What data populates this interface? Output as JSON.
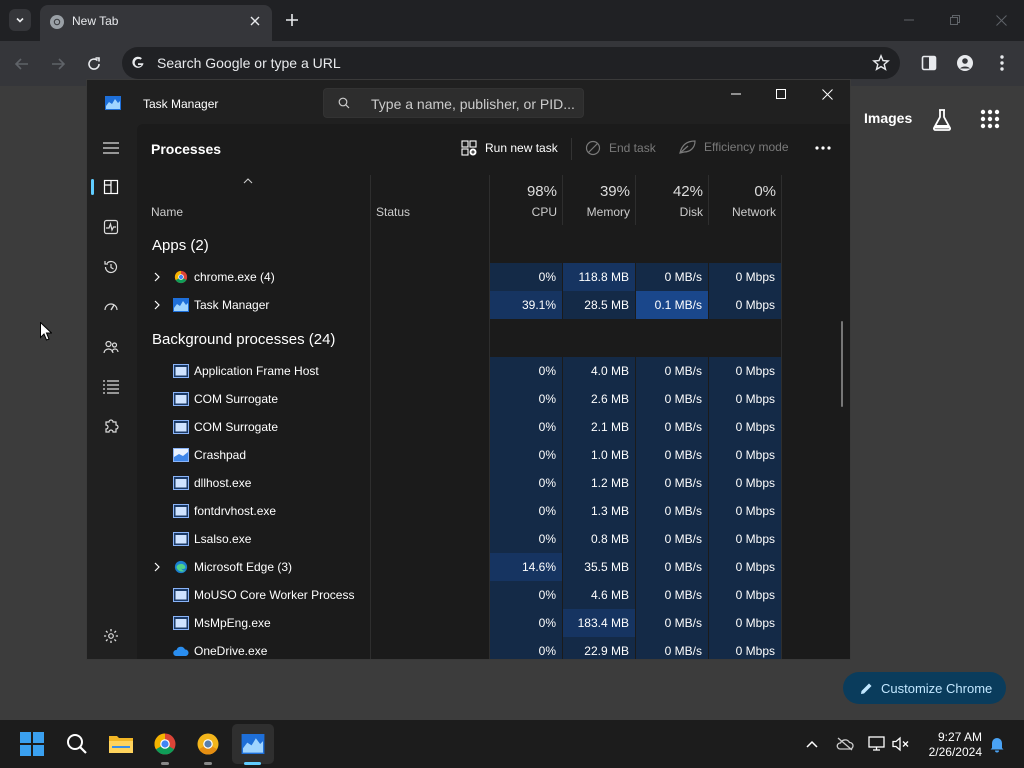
{
  "browser": {
    "tab_title": "New Tab",
    "omnibox_placeholder": "Search Google or type a URL",
    "images_link": "Images",
    "customize_label": "Customize Chrome"
  },
  "task_manager": {
    "title": "Task Manager",
    "search_placeholder": "Type a name, publisher, or PID...",
    "page_title": "Processes",
    "commands": {
      "run_new_task": "Run new task",
      "end_task": "End task",
      "efficiency_mode": "Efficiency mode"
    },
    "columns": {
      "name": "Name",
      "status": "Status",
      "cpu_pct": "98%",
      "cpu": "CPU",
      "memory_pct": "39%",
      "memory": "Memory",
      "disk_pct": "42%",
      "disk": "Disk",
      "network_pct": "0%",
      "network": "Network"
    },
    "apps_group": "Apps (2)",
    "apps": [
      {
        "name": "chrome.exe (4)",
        "cpu": "0%",
        "memory": "118.8 MB",
        "disk": "0 MB/s",
        "network": "0 Mbps"
      },
      {
        "name": "Task Manager",
        "cpu": "39.1%",
        "memory": "28.5 MB",
        "disk": "0.1 MB/s",
        "network": "0 Mbps"
      }
    ],
    "background_group": "Background processes (24)",
    "background": [
      {
        "name": "Application Frame Host",
        "cpu": "0%",
        "memory": "4.0 MB",
        "disk": "0 MB/s",
        "network": "0 Mbps"
      },
      {
        "name": "COM Surrogate",
        "cpu": "0%",
        "memory": "2.6 MB",
        "disk": "0 MB/s",
        "network": "0 Mbps"
      },
      {
        "name": "COM Surrogate",
        "cpu": "0%",
        "memory": "2.1 MB",
        "disk": "0 MB/s",
        "network": "0 Mbps"
      },
      {
        "name": "Crashpad",
        "cpu": "0%",
        "memory": "1.0 MB",
        "disk": "0 MB/s",
        "network": "0 Mbps"
      },
      {
        "name": "dllhost.exe",
        "cpu": "0%",
        "memory": "1.2 MB",
        "disk": "0 MB/s",
        "network": "0 Mbps"
      },
      {
        "name": "fontdrvhost.exe",
        "cpu": "0%",
        "memory": "1.3 MB",
        "disk": "0 MB/s",
        "network": "0 Mbps"
      },
      {
        "name": "Lsalso.exe",
        "cpu": "0%",
        "memory": "0.8 MB",
        "disk": "0 MB/s",
        "network": "0 Mbps"
      },
      {
        "name": "Microsoft Edge (3)",
        "cpu": "14.6%",
        "memory": "35.5 MB",
        "disk": "0 MB/s",
        "network": "0 Mbps"
      },
      {
        "name": "MoUSO Core Worker Process",
        "cpu": "0%",
        "memory": "4.6 MB",
        "disk": "0 MB/s",
        "network": "0 Mbps"
      },
      {
        "name": "MsMpEng.exe",
        "cpu": "0%",
        "memory": "183.4 MB",
        "disk": "0 MB/s",
        "network": "0 Mbps"
      },
      {
        "name": "OneDrive.exe",
        "cpu": "0%",
        "memory": "22.9 MB",
        "disk": "0 MB/s",
        "network": "0 Mbps"
      }
    ]
  },
  "taskbar": {
    "time": "9:27 AM",
    "date": "2/26/2024"
  },
  "colors": {
    "accent": "#60cdff",
    "heat_low": "#142a47",
    "heat_mid": "#163461",
    "heat_high": "#1a478b"
  }
}
